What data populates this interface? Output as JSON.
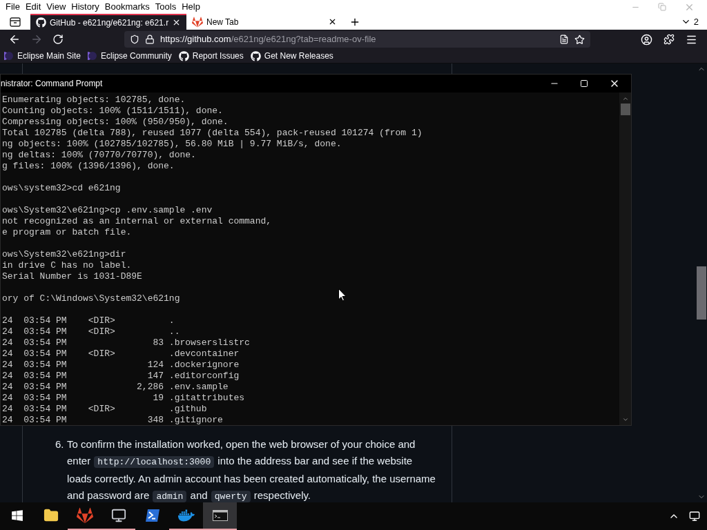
{
  "menu_bar": {
    "items": [
      "File",
      "Edit",
      "View",
      "History",
      "Bookmarks",
      "Tools",
      "Help"
    ]
  },
  "tabs": [
    {
      "title": "GitHub - e621ng/e621ng: e621.r",
      "kind": "github",
      "selected": true
    },
    {
      "title": "New Tab",
      "kind": "fox",
      "selected": false
    }
  ],
  "tab_count": "2",
  "nav": {
    "back_disabled": false,
    "forward_disabled": true,
    "url_host": "https://github.com",
    "url_path": "/e621ng/e621ng?tab=readme-ov-file"
  },
  "bookmarks": [
    {
      "label": "Eclipse Main Site",
      "kind": "eclipse"
    },
    {
      "label": "Eclipse Community",
      "kind": "eclipse"
    },
    {
      "label": "Report Issues",
      "kind": "github"
    },
    {
      "label": "Get New Releases",
      "kind": "github"
    }
  ],
  "page": {
    "list_item": {
      "number": "6.",
      "segments": [
        {
          "text": "To confirm the installation worked, open the web browser of your choice and enter",
          "code": false
        },
        {
          "text": "http://localhost:3000",
          "code": true
        },
        {
          "text": "into the address bar and see if the website loads correctly. An admin account has been created automatically, the username and password are",
          "code": false
        },
        {
          "text": "admin",
          "code": true
        },
        {
          "text": "and",
          "code": false
        },
        {
          "text": "qwerty",
          "code": true
        },
        {
          "text": "respectively.",
          "code": false
        }
      ]
    }
  },
  "console_window": {
    "title": "nistrator: Command Prompt",
    "blocks": [
      [
        "Enumerating objects: 102785, done.",
        "Counting objects: 100% (1511/1511), done.",
        "Compressing objects: 100% (950/950), done.",
        "Total 102785 (delta 788), reused 1077 (delta 554), pack-reused 101274 (from 1)",
        "ng objects: 100% (102785/102785), 56.80 MiB | 9.77 MiB/s, done.",
        "ng deltas: 100% (70770/70770), done.",
        "g files: 100% (1396/1396), done."
      ],
      [
        "ows\\system32>cd e621ng"
      ],
      [
        "ows\\System32\\e621ng>cp .env.sample .env",
        "not recognized as an internal or external command,",
        "e program or batch file."
      ],
      [
        "ows\\System32\\e621ng>dir",
        "in drive C has no label.",
        "Serial Number is 1031-D89E"
      ],
      [
        "ory of C:\\Windows\\System32\\e621ng"
      ],
      [
        "24  03:54 PM    <DIR>          .",
        "24  03:54 PM    <DIR>          ..",
        "24  03:54 PM                83 .browserslistrc",
        "24  03:54 PM    <DIR>          .devcontainer",
        "24  03:54 PM               124 .dockerignore",
        "24  03:54 PM               147 .editorconfig",
        "24  03:54 PM             2,286 .env.sample",
        "24  03:54 PM                19 .gitattributes",
        "24  03:54 PM    <DIR>          .github",
        "24  03:54 PM               348 .gitignore"
      ]
    ]
  },
  "taskbar": {
    "apps": [
      {
        "kind": "start",
        "running": false,
        "active": false
      },
      {
        "kind": "folder",
        "running": false,
        "active": false
      },
      {
        "kind": "fox",
        "running": true,
        "active": false
      },
      {
        "kind": "computers",
        "running": true,
        "active": false
      },
      {
        "kind": "powershell",
        "running": false,
        "active": false
      },
      {
        "kind": "docker",
        "running": true,
        "active": false
      },
      {
        "kind": "terminal",
        "running": true,
        "active": true
      }
    ]
  }
}
